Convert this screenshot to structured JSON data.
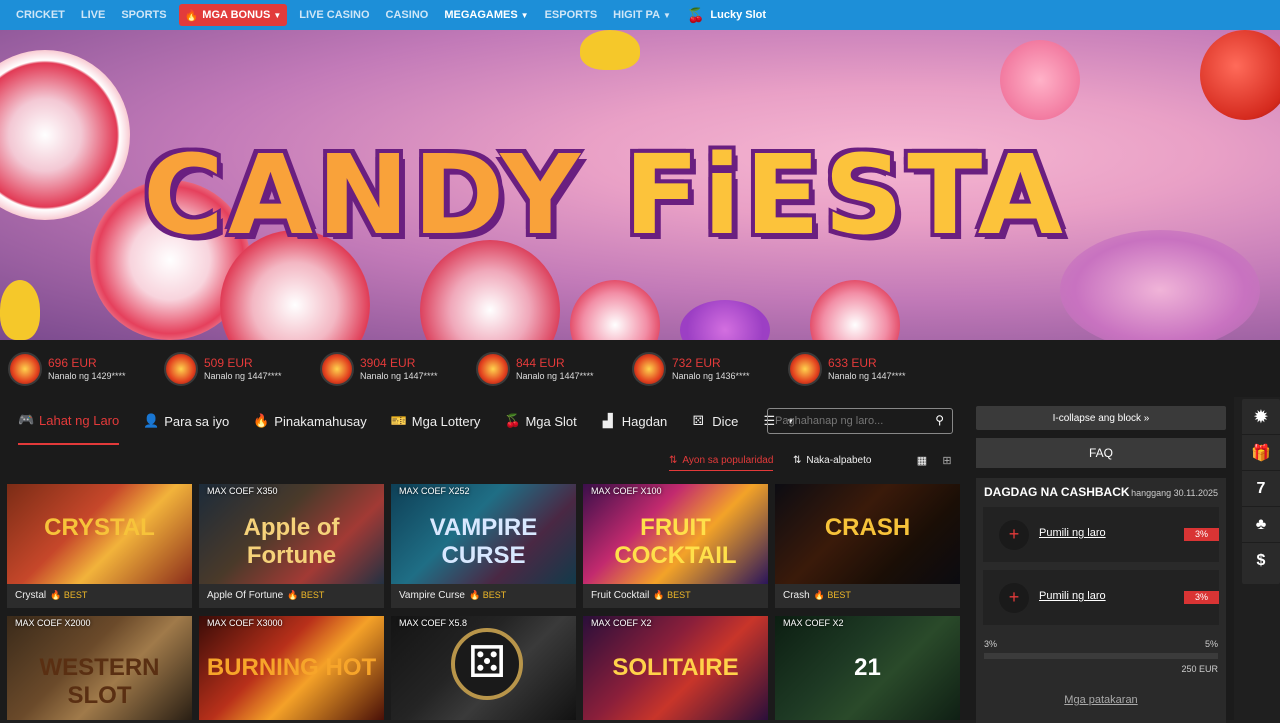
{
  "nav": {
    "items": [
      "CRICKET",
      "LIVE",
      "SPORTS",
      "MGA BONUS",
      "LIVE CASINO",
      "CASINO",
      "MEGAGAMES",
      "ESPORTS",
      "HIGIT PA",
      "Lucky Slot"
    ]
  },
  "banner": {
    "title_word1": "CANDY",
    "title_word2": "FiESTA",
    "slide_count": 12,
    "active_slide": 4
  },
  "winners": [
    {
      "amount": "696 EUR",
      "who": "Nanalo ng 1429****"
    },
    {
      "amount": "509 EUR",
      "who": "Nanalo ng 1447****"
    },
    {
      "amount": "3904 EUR",
      "who": "Nanalo ng 1447****"
    },
    {
      "amount": "844 EUR",
      "who": "Nanalo ng 1447****"
    },
    {
      "amount": "732 EUR",
      "who": "Nanalo ng 1436****"
    },
    {
      "amount": "633 EUR",
      "who": "Nanalo ng 1447****"
    }
  ],
  "tabs": [
    "Lahat ng Laro",
    "Para sa iyo",
    "Pinakamahusay",
    "Mga Lottery",
    "Mga Slot",
    "Hagdan",
    "Dice"
  ],
  "search": {
    "placeholder": "Paghahanap ng laro..."
  },
  "sort": {
    "popular": "Ayon sa popularidad",
    "alpha": "Naka-alpabeto"
  },
  "games_row1": [
    {
      "name": "Crystal",
      "badge": "BEST",
      "coef": "",
      "art": "CRYSTAL"
    },
    {
      "name": "Apple Of Fortune",
      "badge": "BEST",
      "coef": "MAX COEF X350",
      "art": "Apple of Fortune"
    },
    {
      "name": "Vampire Curse",
      "badge": "BEST",
      "coef": "MAX COEF X252",
      "art": "VAMPIRE CURSE"
    },
    {
      "name": "Fruit Cocktail",
      "badge": "BEST",
      "coef": "MAX COEF X100",
      "art": "FRUIT COCKTAIL"
    },
    {
      "name": "Crash",
      "badge": "BEST",
      "coef": "",
      "art": "CRASH"
    }
  ],
  "games_row2": [
    {
      "coef": "MAX COEF X2000",
      "art": "WESTERN SLOT"
    },
    {
      "coef": "MAX COEF X3000",
      "art": "BURNING HOT"
    },
    {
      "coef": "MAX COEF X5.8",
      "art": ""
    },
    {
      "coef": "MAX COEF X2",
      "art": "SOLITAIRE"
    },
    {
      "coef": "MAX COEF X2",
      "art": "21"
    }
  ],
  "right": {
    "collapse": "I-collapse ang block »",
    "faq": "FAQ",
    "cashback_title": "DAGDAG NA CASHBACK",
    "cashback_until": "hanggang 30.11.2025",
    "picks": [
      {
        "label": "Pumili ng laro",
        "pct": "3%"
      },
      {
        "label": "Pumili ng laro",
        "pct": "3%"
      }
    ],
    "progress_min": "3%",
    "progress_max": "5%",
    "progress_amount": "250 EUR",
    "rules": "Mga patakaran"
  },
  "sidebar": {
    "seven": "7"
  }
}
